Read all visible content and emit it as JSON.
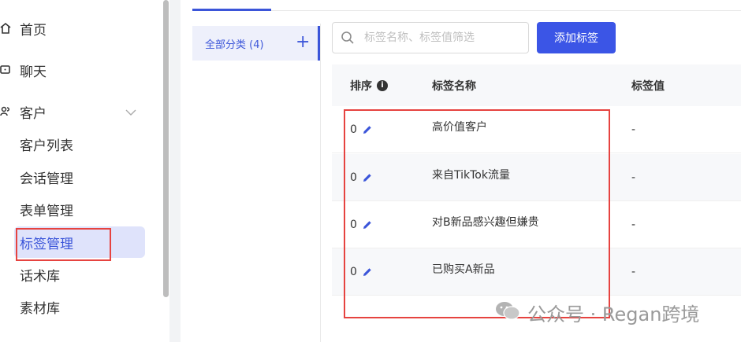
{
  "sidebar": {
    "items": [
      {
        "label": "首页",
        "icon": "home-icon"
      },
      {
        "label": "聊天",
        "icon": "chat-icon"
      },
      {
        "label": "客户",
        "icon": "customers-icon"
      }
    ],
    "submenu": [
      {
        "label": "客户列表"
      },
      {
        "label": "会话管理"
      },
      {
        "label": "表单管理"
      },
      {
        "label": "标签管理",
        "active": true
      },
      {
        "label": "话术库"
      },
      {
        "label": "素材库"
      }
    ]
  },
  "categories": {
    "all_label": "全部分类 (4)",
    "add_symbol": "+"
  },
  "search": {
    "placeholder": "标签名称、标签值筛选"
  },
  "toolbar": {
    "add_label": "添加标签"
  },
  "table": {
    "headers": {
      "order": "排序",
      "info": "i",
      "name": "标签名称",
      "value": "标签值"
    },
    "rows": [
      {
        "order": "0",
        "name": "高价值客户",
        "value": "-"
      },
      {
        "order": "0",
        "name": "来自TikTok流量",
        "value": "-"
      },
      {
        "order": "0",
        "name": "对B新品感兴趣但嫌贵",
        "value": "-"
      },
      {
        "order": "0",
        "name": "已购买A新品",
        "value": "-"
      }
    ]
  },
  "watermark": {
    "text": "公众号 · Regan跨境"
  },
  "colors": {
    "accent": "#3b55e6",
    "highlight": "#e64340",
    "active_bg": "#dfe3fb"
  }
}
